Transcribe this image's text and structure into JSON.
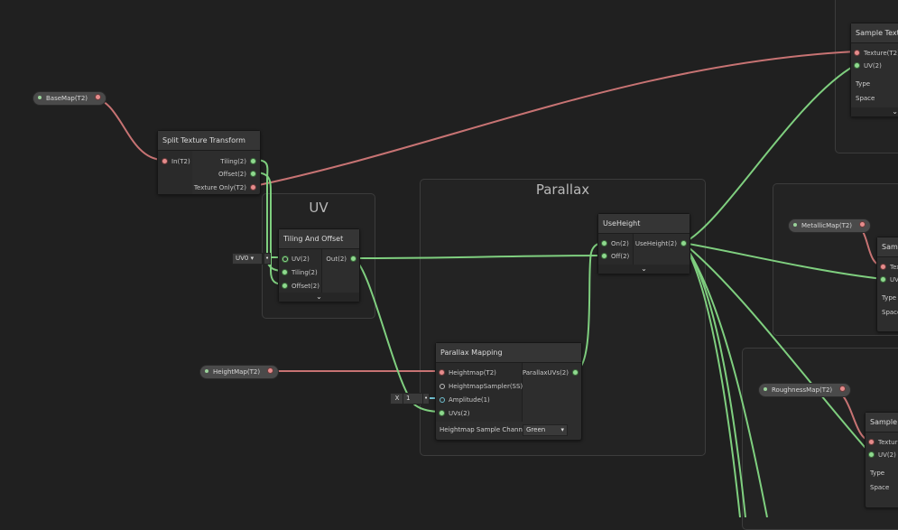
{
  "groups": {
    "uv": {
      "title": "UV"
    },
    "parallax": {
      "title": "Parallax"
    }
  },
  "properties": {
    "basemap": "BaseMap(T2)",
    "heightmap": "HeightMap(T2)",
    "metallicmap": "MetallicMap(T2)",
    "roughnessmap": "RoughnessMap(T2)"
  },
  "nodes": {
    "split": {
      "title": "Split Texture Transform",
      "in": "In(T2)",
      "tiling": "Tiling(2)",
      "offset": "Offset(2)",
      "texonly": "Texture Only(T2)"
    },
    "tiling": {
      "title": "Tiling And Offset",
      "uv": "UV(2)",
      "tiling": "Tiling(2)",
      "offset": "Offset(2)",
      "out": "Out(2)",
      "uv_field": "UV0",
      "expand": "⌄"
    },
    "useheight": {
      "title": "UseHeight",
      "on": "On(2)",
      "off": "Off(2)",
      "out": "UseHeight(2)",
      "expand": "⌄"
    },
    "parallax": {
      "title": "Parallax Mapping",
      "heightmap": "Heightmap(T2)",
      "sampler": "HeightmapSampler(SS)",
      "amplitude": "Amplitude(1)",
      "uvs": "UVs(2)",
      "out": "ParallaxUVs(2)",
      "channel_label": "Heightmap Sample Channel",
      "channel_value": "Green",
      "amp_x": "X",
      "amp_value": "1"
    },
    "sample1": {
      "title": "Sample Textu",
      "texture": "Texture(T2)",
      "uv": "UV(2)",
      "type": "Type",
      "space": "Space",
      "expand": "⌄"
    },
    "sample2": {
      "title": "Samp",
      "texture": "Textu",
      "uv": "UV",
      "type": "Type",
      "space": "Space"
    },
    "sample3": {
      "title": "Sample T",
      "texture": "Textur",
      "uv": "UV(2)",
      "type": "Type",
      "space": "Space"
    }
  },
  "colors": {
    "background": "#202020",
    "wire_green": "#7fcf7f",
    "wire_red": "#cf7a7a",
    "wire_cyan": "#6fbfcf"
  }
}
